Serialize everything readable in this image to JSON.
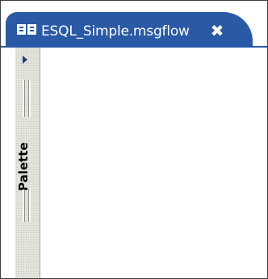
{
  "editor": {
    "tab_title": "ESQL_Simple.msgflow",
    "tab_icon": "message-flow-icon",
    "close_icon": "close-icon",
    "close_glyph": "✖"
  },
  "palette": {
    "label": "Palette",
    "expand_icon": "triangle-right-icon"
  },
  "colors": {
    "tab_active": "#2a5aa6",
    "palette_bg": "#e4e3dc",
    "canvas_bg": "#ffffff"
  }
}
